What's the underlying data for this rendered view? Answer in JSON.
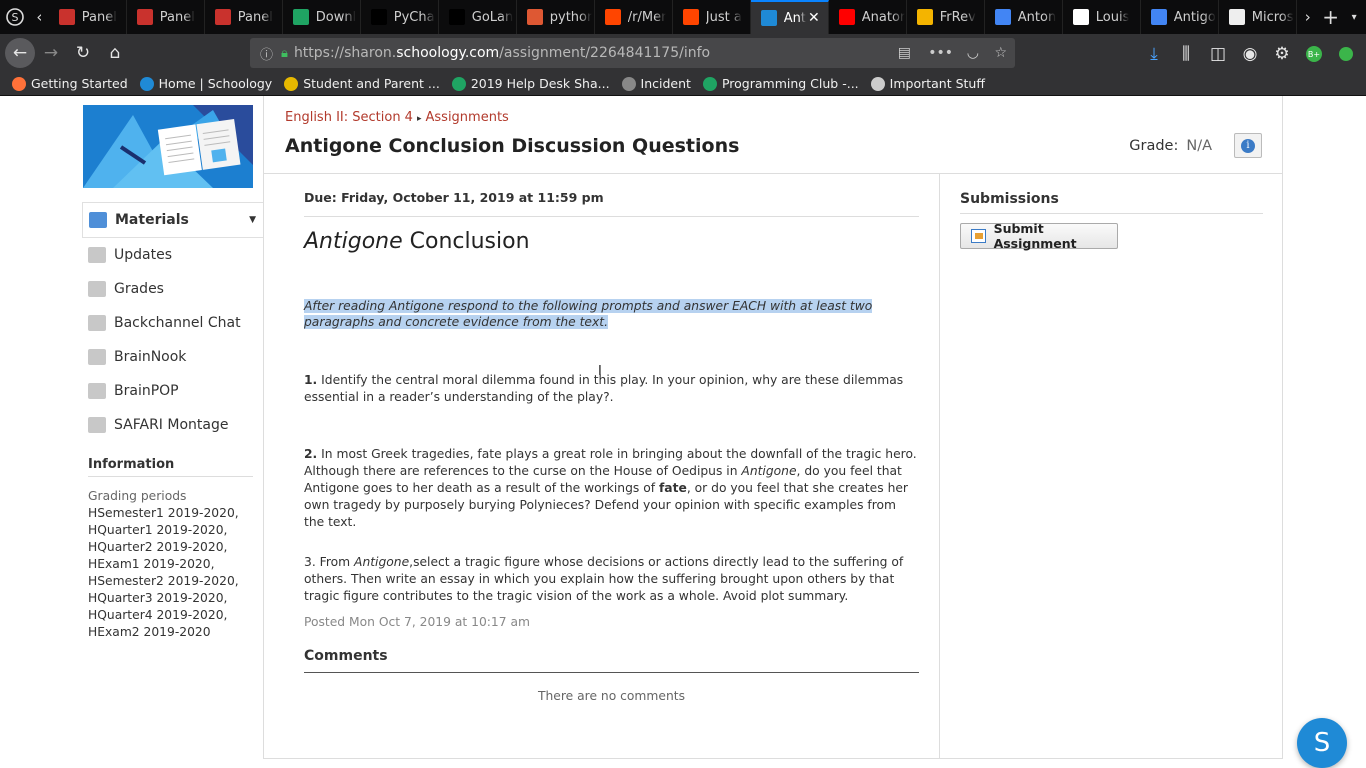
{
  "browser": {
    "tabs": [
      {
        "label": "Panel",
        "icon": "pdf-icon",
        "color": "#c9322d"
      },
      {
        "label": "Panel",
        "icon": "pdf-icon",
        "color": "#c9322d"
      },
      {
        "label": "Panel",
        "icon": "pdf-icon",
        "color": "#c9322d"
      },
      {
        "label": "Downl",
        "icon": "drive-icon",
        "color": "#1fa463"
      },
      {
        "label": "PyCha",
        "icon": "jetbrains-icon",
        "color": "#000000"
      },
      {
        "label": "GoLan",
        "icon": "jetbrains-icon",
        "color": "#000000"
      },
      {
        "label": "pythor",
        "icon": "duckduckgo-icon",
        "color": "#de5833"
      },
      {
        "label": "/r/Mer",
        "icon": "reddit-icon",
        "color": "#ff4500"
      },
      {
        "label": "Just a",
        "icon": "reddit-icon",
        "color": "#ff4500"
      },
      {
        "label": "Ant",
        "icon": "schoology-icon",
        "color": "#1f8ad6",
        "active": true
      },
      {
        "label": "Anator",
        "icon": "youtube-icon",
        "color": "#ff0000"
      },
      {
        "label": "FrRev",
        "icon": "slides-icon",
        "color": "#f4b400"
      },
      {
        "label": "Anton",
        "icon": "docs-icon",
        "color": "#4285f4"
      },
      {
        "label": "Louis",
        "icon": "wikipedia-icon",
        "color": "#ffffff"
      },
      {
        "label": "Antigo",
        "icon": "docs-icon",
        "color": "#4285f4"
      },
      {
        "label": "Micros",
        "icon": "blank-page-icon",
        "color": "#eeeeee"
      }
    ],
    "url_prefix": "https://sharon.",
    "url_domain": "schoology.com",
    "url_path": "/assignment/2264841175/info",
    "bookmarks": [
      {
        "label": "Getting Started",
        "icon": "firefox-icon",
        "color": "#ff7139"
      },
      {
        "label": "Home | Schoology",
        "icon": "schoology-icon",
        "color": "#1f8ad6"
      },
      {
        "label": "Student and Parent ...",
        "icon": "bookmark-icon",
        "color": "#e6b800"
      },
      {
        "label": "2019 Help Desk Sha...",
        "icon": "drive-icon",
        "color": "#1fa463"
      },
      {
        "label": "Incident",
        "icon": "globe-icon",
        "color": "#888888"
      },
      {
        "label": "Programming Club -...",
        "icon": "drive-icon",
        "color": "#1fa463"
      },
      {
        "label": "Important Stuff",
        "icon": "folder-icon",
        "color": "#cccccc"
      }
    ]
  },
  "sidebar": {
    "items": [
      {
        "label": "Materials",
        "active": true
      },
      {
        "label": "Updates"
      },
      {
        "label": "Grades"
      },
      {
        "label": "Backchannel Chat"
      },
      {
        "label": "BrainNook"
      },
      {
        "label": "BrainPOP"
      },
      {
        "label": "SAFARI Montage"
      }
    ],
    "info_heading": "Information",
    "grading_label": "Grading periods",
    "grading_periods": [
      "HSemester1 2019-2020,",
      "HQuarter1 2019-2020,",
      "HQuarter2 2019-2020,",
      "HExam1 2019-2020,",
      "HSemester2 2019-2020,",
      "HQuarter3 2019-2020,",
      "HQuarter4 2019-2020,",
      "HExam2 2019-2020"
    ]
  },
  "header": {
    "course": "English II: Section 4",
    "section": "Assignments",
    "title": "Antigone Conclusion Discussion Questions",
    "grade_label": "Grade:",
    "grade_value": "N/A"
  },
  "assignment": {
    "due": "Due: Friday, October 11, 2019 at 11:59 pm",
    "heading_italic": "Antigone",
    "heading_rest": " Conclusion",
    "intro": "After reading Antigone respond to the following prompts and answer EACH with at least two paragraphs and concrete evidence from the text.",
    "q1_num": "1.",
    "q1": " Identify the central moral dilemma found in this play. In your opinion, why are these dilemmas essential in a reader’s understanding of the play?.",
    "q2_num": "2.",
    "q2_a": " In most Greek tragedies, fate plays a great role in bringing about the downfall of the tragic hero. Although there are references to the curse on the House of Oedipus in ",
    "q2_b": "Antigone",
    "q2_c": ", do you feel that Antigone goes to her death as a result of the workings of ",
    "q2_d": "fate",
    "q2_e": ", or do you feel that she creates her own tragedy by purposely burying Polynieces? Defend your opinion with specific examples from the text.",
    "q3_a": "3. From ",
    "q3_b": "Antigone",
    "q3_c": ",select a tragic figure whose decisions or actions directly lead to the suffering of others.  Then write an essay in which you explain how the suffering brought upon others by that tragic figure contributes to the tragic vision of the work as a whole.  Avoid plot summary.",
    "posted": "Posted Mon Oct 7, 2019 at 10:17 am",
    "comments_heading": "Comments",
    "no_comments": "There are no comments"
  },
  "submissions": {
    "heading": "Submissions",
    "button": "Submit Assignment"
  },
  "help_button": "S"
}
